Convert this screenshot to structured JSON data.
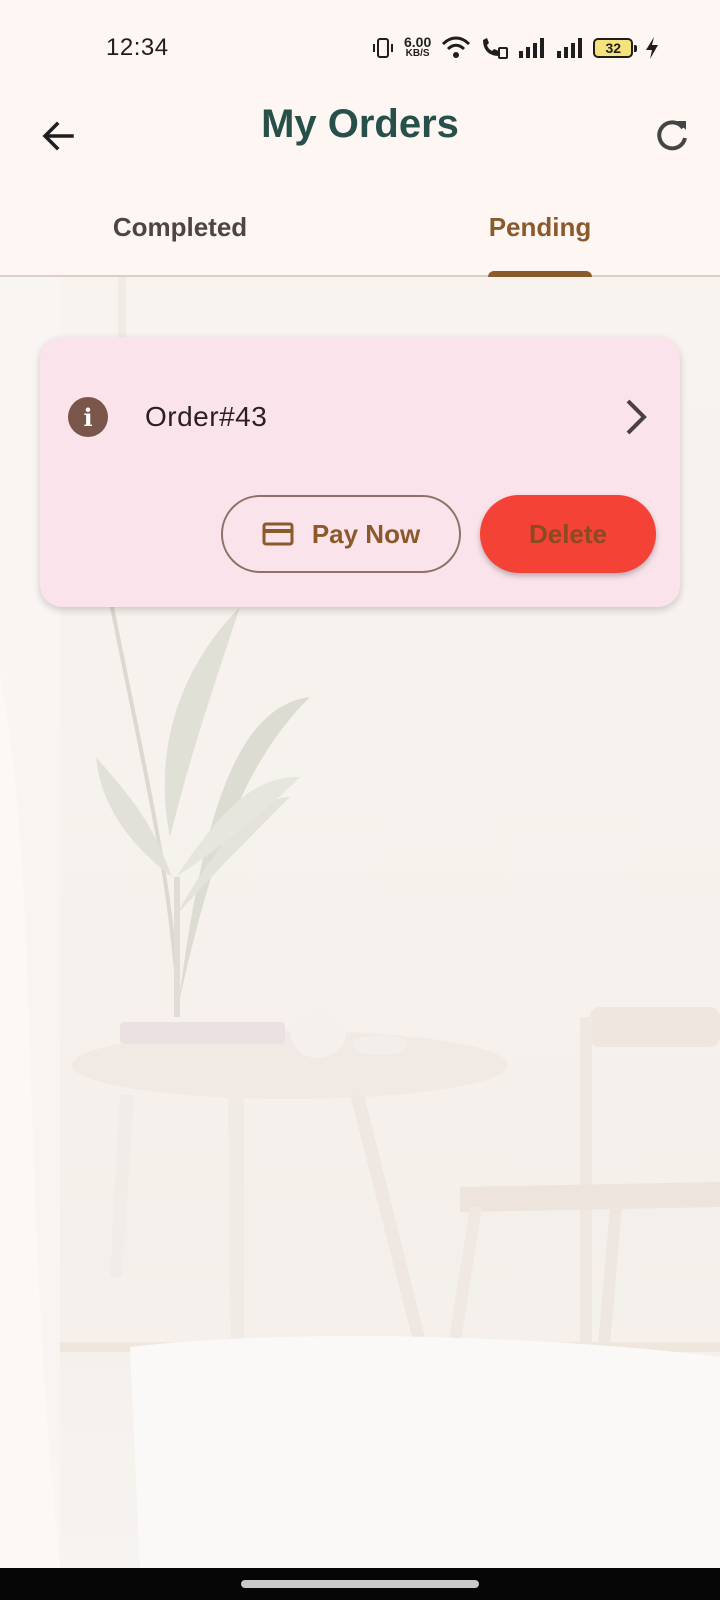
{
  "status_bar": {
    "time": "12:34",
    "net_speed_value": "6.00",
    "net_speed_unit": "KB/S",
    "battery_level": "32",
    "icons": [
      "vibrate-icon",
      "wifi-icon",
      "wifi-calling-icon",
      "signal-icon",
      "signal-icon",
      "battery-icon",
      "charging-icon"
    ]
  },
  "app_bar": {
    "title": "My Orders",
    "back_icon": "arrow-left-icon",
    "refresh_icon": "refresh-icon"
  },
  "tabs": {
    "items": [
      {
        "label": "Completed",
        "selected": false
      },
      {
        "label": "Pending",
        "selected": true
      }
    ]
  },
  "orders": [
    {
      "title": "Order#43",
      "pay_label": "Pay Now",
      "delete_label": "Delete"
    }
  ],
  "colors": {
    "title": "#28504a",
    "accent": "#8a5a2b",
    "card_background": "#fbe3ec",
    "delete_background": "#f44336",
    "info_icon": "#7a5549"
  }
}
